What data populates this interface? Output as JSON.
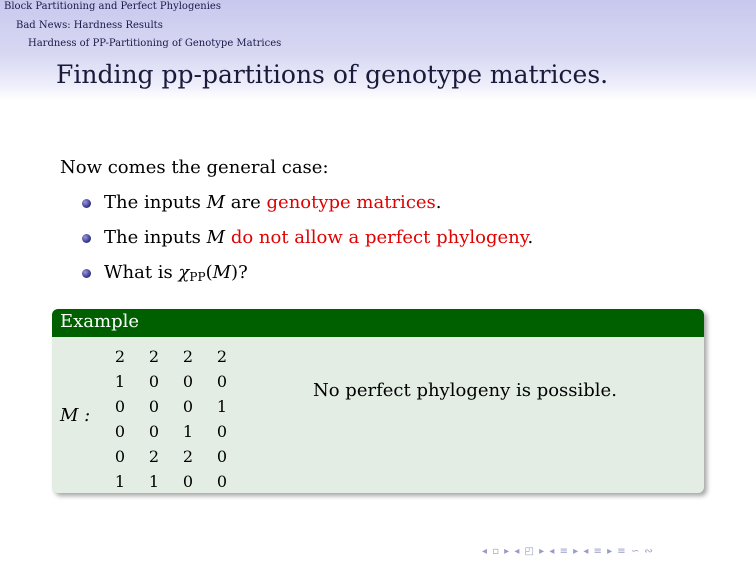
{
  "nav": {
    "section": "Block Partitioning and Perfect Phylogenies",
    "subsection": "Bad News: Hardness Results",
    "subsubsection": "Hardness of PP-Partitioning of Genotype Matrices"
  },
  "frame": {
    "title": "Finding pp-partitions of genotype matrices."
  },
  "body": {
    "intro": "Now comes the general case:",
    "bullets": [
      {
        "pre": "The inputs ",
        "var": "M",
        "mid": " are ",
        "highlight": "genotype matrices",
        "post": "."
      },
      {
        "pre": "The inputs ",
        "var": "M",
        "mid": " ",
        "highlight": "do not allow a perfect phylogeny",
        "post": "."
      },
      {
        "pre": "What is ",
        "chi": "χ",
        "sub": "PP",
        "open": "(",
        "var": "M",
        "close": ")?"
      }
    ]
  },
  "example": {
    "title": "Example",
    "matrix_label": "M :",
    "matrix": [
      [
        "2",
        "2",
        "2",
        "2"
      ],
      [
        "1",
        "0",
        "0",
        "0"
      ],
      [
        "0",
        "0",
        "0",
        "1"
      ],
      [
        "0",
        "0",
        "1",
        "0"
      ],
      [
        "0",
        "2",
        "2",
        "0"
      ],
      [
        "1",
        "1",
        "0",
        "0"
      ]
    ],
    "note": "No perfect phylogeny is possible."
  },
  "colors": {
    "highlight": "#e00000",
    "block_title_bg": "#006000",
    "block_body_bg": "#e3ede3",
    "header_bg": "#c8c8ee"
  },
  "navigation_symbols": "◂ ▫ ▸ ◂ ◰ ▸ ◂ ≡ ▸ ◂ ≡ ▸ ≡ ∽ ∾"
}
